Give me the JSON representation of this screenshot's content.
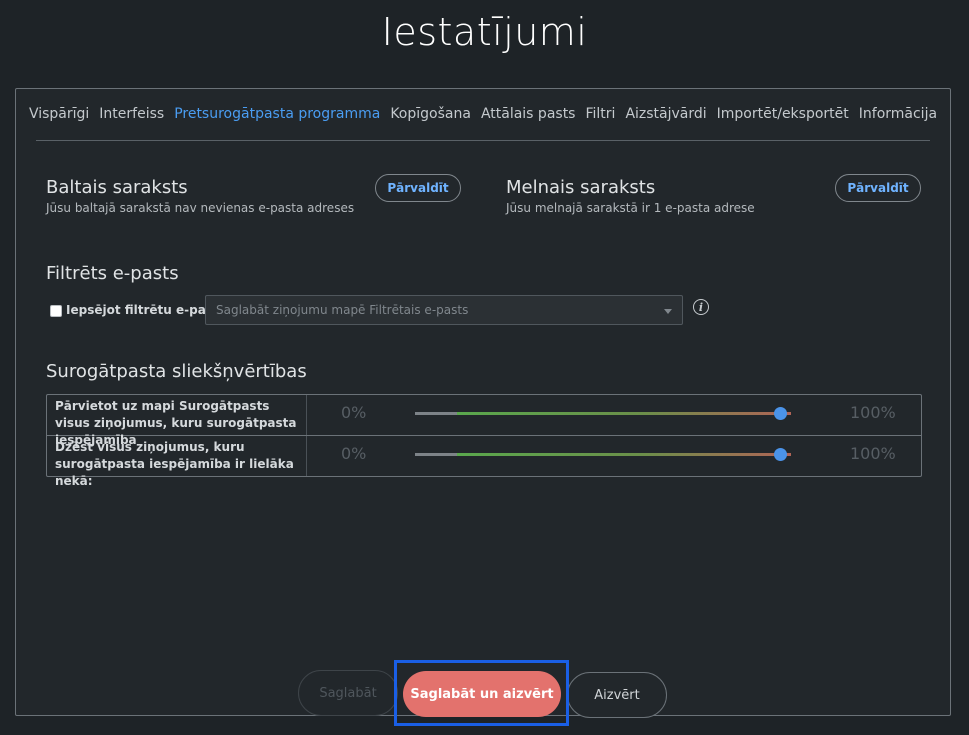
{
  "title": "Iestatījumi",
  "tabs": [
    {
      "label": "Vispārīgi"
    },
    {
      "label": "Interfeiss"
    },
    {
      "label": "Pretsurogātpasta programma"
    },
    {
      "label": "Kopīgošana"
    },
    {
      "label": "Attālais pasts"
    },
    {
      "label": "Filtri"
    },
    {
      "label": "Aizstājvārdi"
    },
    {
      "label": "Importēt/eksportēt"
    },
    {
      "label": "Informācija"
    }
  ],
  "active_tab": "Pretsurogātpasta programma",
  "whitelist": {
    "heading": "Baltais saraksts",
    "description": "Jūsu baltajā sarakstā nav nevienas e-pasta adreses",
    "manage_label": "Pārvaldīt"
  },
  "blacklist": {
    "heading": "Melnais saraksts",
    "description": "Jūsu melnajā sarakstā ir 1 e-pasta adrese",
    "manage_label": "Pārvaldīt"
  },
  "filtered": {
    "heading": "Filtrēts e-pasts",
    "checkbox_label": "Iepsējot filtrētu e-pastu",
    "checkbox_checked": false,
    "select_value": "Saglabāt ziņojumu mapē Filtrētais e-pasts",
    "info_icon": "info-icon"
  },
  "thresholds": {
    "heading": "Surogātpasta sliekšņvērtības",
    "rows": [
      {
        "label": "Pārvietot uz mapi Surogātpasts visus ziņojumus, kuru surogātpasta iespējamība",
        "min": "0%",
        "max": "100%",
        "value_fraction": 0.97
      },
      {
        "label": "Dzēst visus ziņojumus, kuru surogātpasta iespējamība ir lielāka nekā:",
        "min": "0%",
        "max": "100%",
        "value_fraction": 0.97
      }
    ]
  },
  "buttons": {
    "save": "Saglabāt",
    "save_close": "Saglabāt un aizvērt",
    "close": "Aizvērt"
  },
  "colors": {
    "accent": "#4a9df2",
    "primary_button": "#e3726d",
    "highlight_box": "#1a5fe6"
  }
}
